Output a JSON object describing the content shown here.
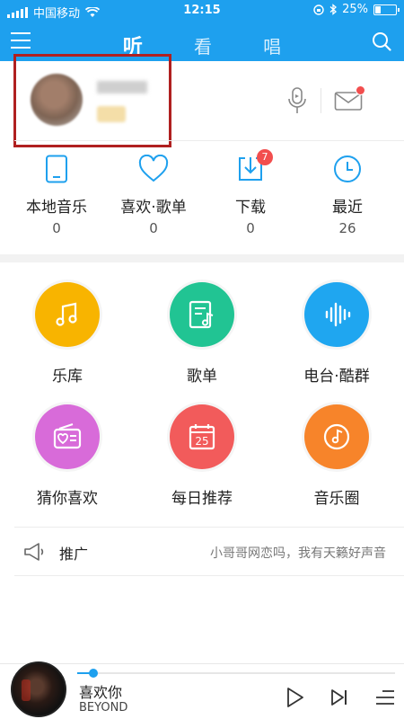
{
  "status_bar": {
    "carrier": "中国移动",
    "time": "12:15",
    "battery": "25%",
    "battery_level": 0.25
  },
  "header": {
    "tabs": [
      "听",
      "看",
      "唱"
    ],
    "active_tab": 0
  },
  "quick_links": [
    {
      "icon": "phone-icon",
      "label": "本地音乐",
      "count": "0"
    },
    {
      "icon": "heart-icon",
      "label": "喜欢·歌单",
      "count": "0"
    },
    {
      "icon": "download-icon",
      "label": "下载",
      "count": "0",
      "badge": "7"
    },
    {
      "icon": "clock-icon",
      "label": "最近",
      "count": "26"
    }
  ],
  "grid": [
    {
      "icon": "music-note-icon",
      "label": "乐库",
      "color": "#f8b400"
    },
    {
      "icon": "playlist-icon",
      "label": "歌单",
      "color": "#21c493"
    },
    {
      "icon": "radio-wave-icon",
      "label": "电台·酷群",
      "color": "#1fa6f0"
    },
    {
      "icon": "radio-heart-icon",
      "label": "猜你喜欢",
      "color": "#d86bd9"
    },
    {
      "icon": "calendar-icon",
      "label": "每日推荐",
      "color": "#f25b5b",
      "day": "25"
    },
    {
      "icon": "vinyl-note-icon",
      "label": "音乐圈",
      "color": "#f7842a"
    }
  ],
  "promo": {
    "icon": "megaphone-icon",
    "title": "推广",
    "desc": "小哥哥网恋吗，我有天籁好声音"
  },
  "player": {
    "song": "喜欢你",
    "artist": "BEYOND",
    "progress": 0.05
  },
  "colors": {
    "accent": "#1ea0ee",
    "badge": "#f24e4e"
  }
}
